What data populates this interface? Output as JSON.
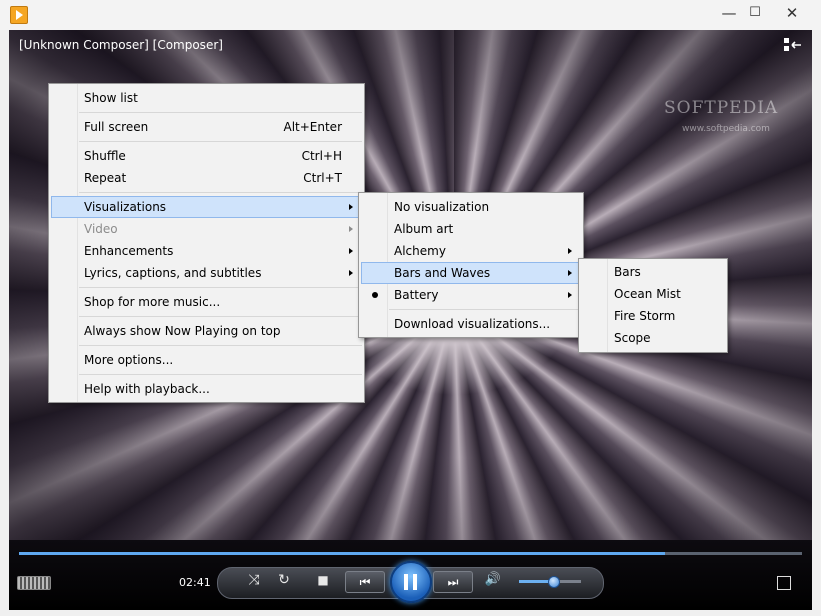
{
  "window": {
    "minimize": "—",
    "maximize": "☐",
    "close": "✕"
  },
  "player": {
    "title": "[Unknown Composer] [Composer]",
    "watermark": "SOFTPEDIA",
    "watermark_url": "www.softpedia.com",
    "time": "02:41",
    "seek_progress": 0.825,
    "volume_level": 0.55,
    "accent_color": "#5fa8f0"
  },
  "context_menu": {
    "items": [
      {
        "label": "Show list",
        "shortcut": ""
      },
      {
        "label": "Full screen",
        "shortcut": "Alt+Enter"
      },
      {
        "label": "Shuffle",
        "shortcut": "Ctrl+H"
      },
      {
        "label": "Repeat",
        "shortcut": "Ctrl+T"
      },
      {
        "label": "Visualizations",
        "shortcut": ""
      },
      {
        "label": "Video",
        "shortcut": ""
      },
      {
        "label": "Enhancements",
        "shortcut": ""
      },
      {
        "label": "Lyrics, captions, and subtitles",
        "shortcut": ""
      },
      {
        "label": "Shop for more music...",
        "shortcut": ""
      },
      {
        "label": "Always show Now Playing on top",
        "shortcut": ""
      },
      {
        "label": "More options...",
        "shortcut": ""
      },
      {
        "label": "Help with playback...",
        "shortcut": ""
      }
    ]
  },
  "visualizations_menu": {
    "items": [
      {
        "label": "No visualization"
      },
      {
        "label": "Album art"
      },
      {
        "label": "Alchemy"
      },
      {
        "label": "Bars and Waves"
      },
      {
        "label": "Battery"
      },
      {
        "label": "Download visualizations..."
      }
    ]
  },
  "bars_waves_menu": {
    "items": [
      {
        "label": "Bars"
      },
      {
        "label": "Ocean Mist"
      },
      {
        "label": "Fire Storm"
      },
      {
        "label": "Scope"
      }
    ]
  },
  "controls": {
    "shuffle_icon": "⤨",
    "repeat_icon": "↻",
    "stop_icon": "■",
    "prev_icon": "⏮",
    "next_icon": "⏭",
    "volume_icon": "🔊"
  }
}
